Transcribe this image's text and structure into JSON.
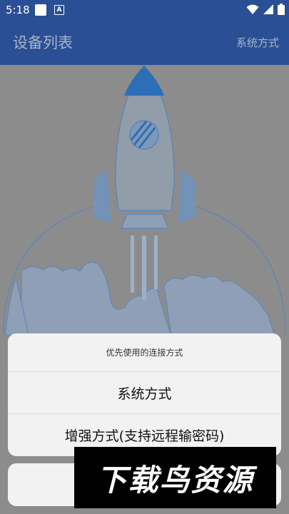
{
  "status_bar": {
    "time": "5:18",
    "app_badge": "A"
  },
  "app_bar": {
    "title": "设备列表",
    "action": "系统方式"
  },
  "sheet": {
    "title": "优先使用的连接方式",
    "options": [
      "系统方式",
      "增强方式(支持远程输密码)"
    ]
  },
  "watermark": {
    "text": "下载鸟资源"
  },
  "colors": {
    "primary": "#2a4f95",
    "dim_background": "#8c8c8c",
    "sheet": "#f2f2f2",
    "rocket_accent": "#2c6fb7"
  },
  "icons": {
    "status": [
      "notification-square-icon",
      "app-badge-icon",
      "wifi-icon",
      "signal-icon",
      "battery-icon"
    ],
    "illustration": "rocket-illustration"
  }
}
